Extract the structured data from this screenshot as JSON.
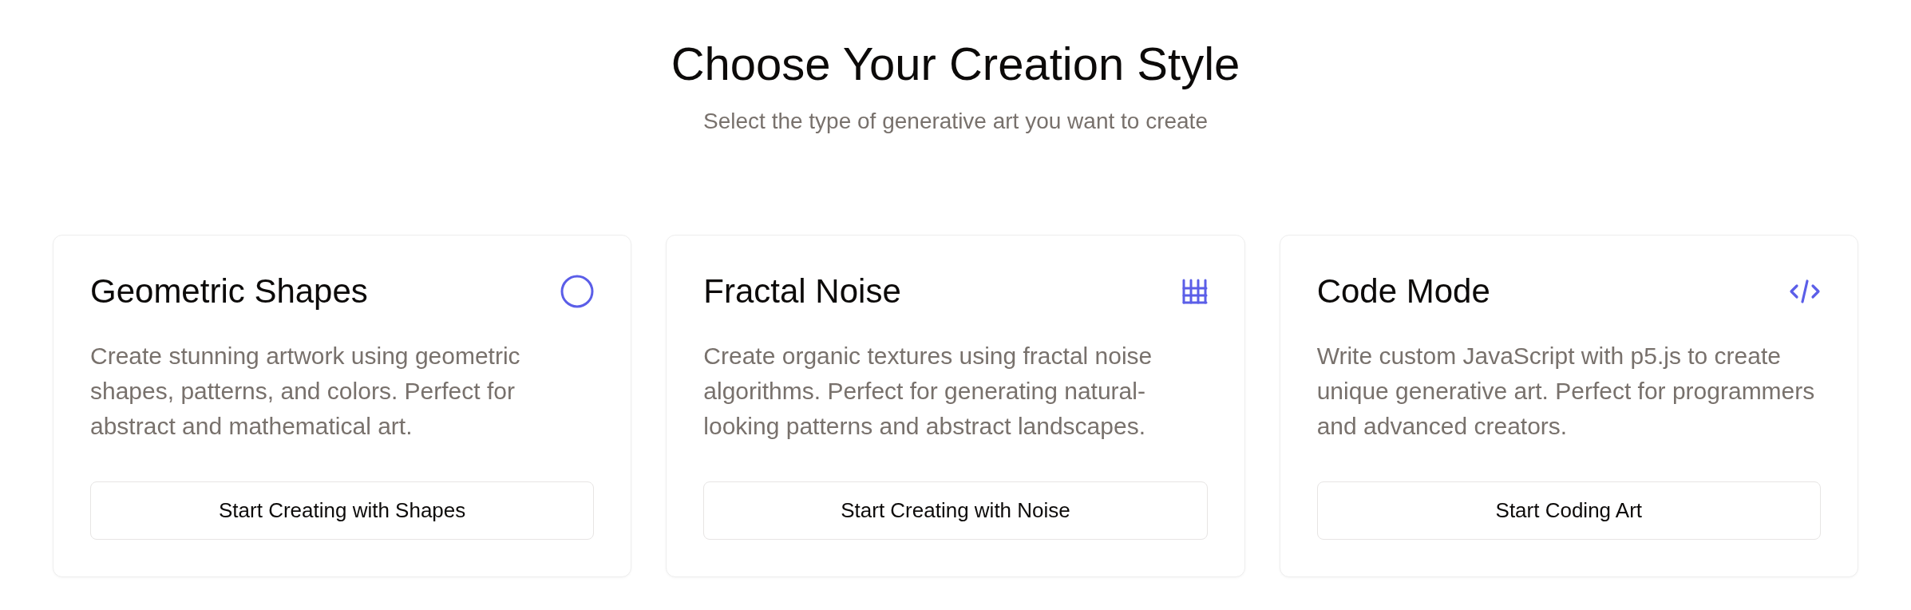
{
  "header": {
    "title": "Choose Your Creation Style",
    "subtitle": "Select the type of generative art you want to create"
  },
  "cards": [
    {
      "kind": "shapes",
      "title": "Geometric Shapes",
      "description": "Create stunning artwork using geometric shapes, patterns, and colors. Perfect for abstract and mathematical art.",
      "button": "Start Creating with Shapes"
    },
    {
      "kind": "noise",
      "title": "Fractal Noise",
      "description": "Create organic textures using fractal noise algorithms. Perfect for generating natural-looking patterns and abstract landscapes.",
      "button": "Start Creating with Noise"
    },
    {
      "kind": "code",
      "title": "Code Mode",
      "description": "Write custom JavaScript with p5.js to create unique generative art. Perfect for programmers and advanced creators.",
      "button": "Start Coding Art"
    }
  ]
}
